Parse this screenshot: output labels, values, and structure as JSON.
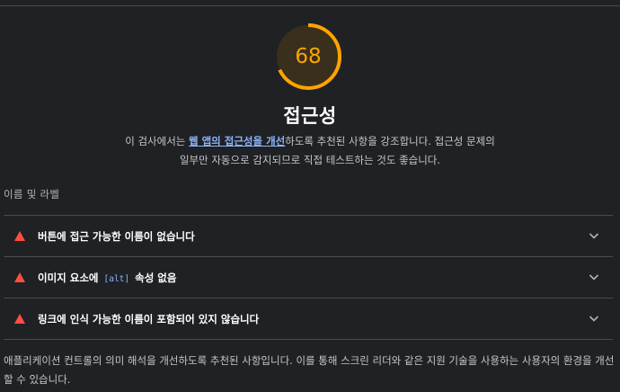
{
  "category": {
    "score": "68",
    "score_fraction": 0.68,
    "gauge_color": "#ffa400",
    "title": "접근성",
    "description_before_link": "이 검사에서는 ",
    "description_link": "웹 앱의 접근성을 개선",
    "description_after_link": "하도록 추천된 사항을 강조합니다. 접근성 문제의 일부만 자동으로 감지되므로 직접 테스트하는 것도 좋습니다."
  },
  "group": {
    "title": "이름 및 라벨",
    "description": "애플리케이션 컨트롤의 의미 해석을 개선하도록 추천된 사항입니다. 이를 통해 스크린 리더와 같은 지원 기술을 사용하는 사용자의 환경을 개선할 수 있습니다."
  },
  "audits": [
    {
      "status": "fail",
      "title": "버튼에 접근 가능한 이름이 없습니다",
      "status_icon": "fail-triangle-icon",
      "expand_icon": "chevron-down-icon"
    },
    {
      "status": "fail",
      "title_before_code": "이미지 요소에 ",
      "code": "[alt]",
      "title_after_code": " 속성 없음",
      "status_icon": "fail-triangle-icon",
      "expand_icon": "chevron-down-icon"
    },
    {
      "status": "fail",
      "title": "링크에 인식 가능한 이름이 포함되어 있지 않습니다",
      "status_icon": "fail-triangle-icon",
      "expand_icon": "chevron-down-icon"
    }
  ],
  "colors": {
    "background": "#202124",
    "fail": "#ff4e42",
    "link": "#8ab4f8",
    "average": "#ffa400"
  }
}
